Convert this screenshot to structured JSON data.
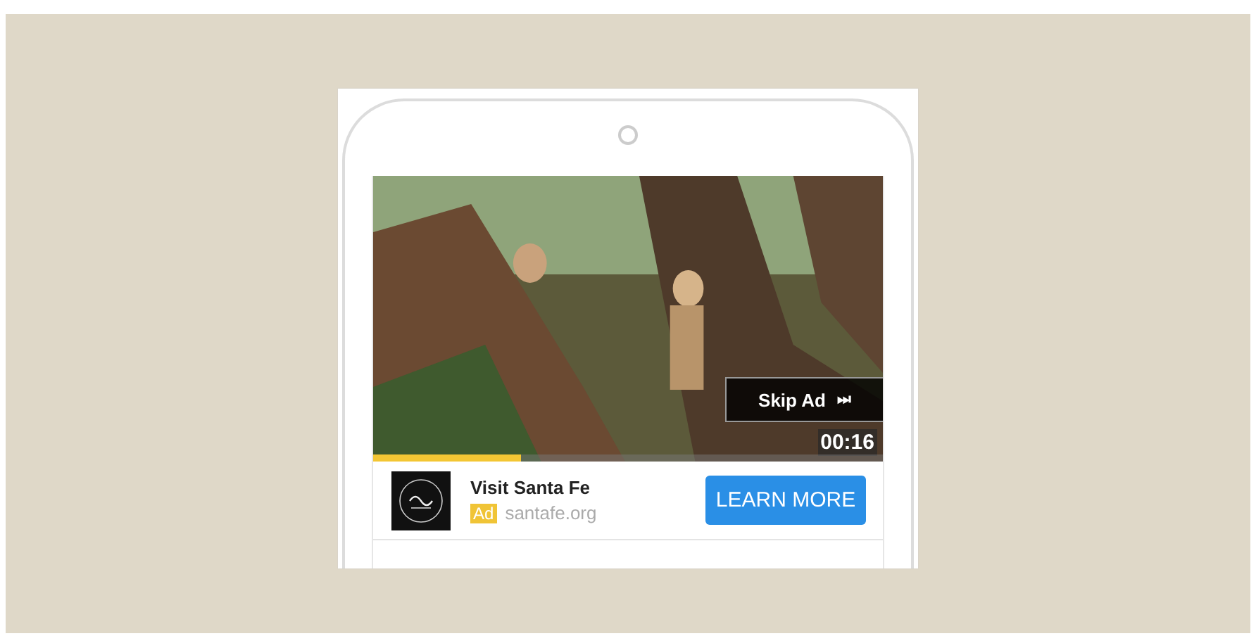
{
  "video": {
    "skip_button": "Skip Ad",
    "skip_icon": "⏭",
    "time": "00:16",
    "progress": {
      "level": 0.29
    }
  },
  "ad": {
    "title": "Visit Santa Fe",
    "badge": "Ad",
    "domain": "santafe.org",
    "button": "LEARN MORE"
  }
}
